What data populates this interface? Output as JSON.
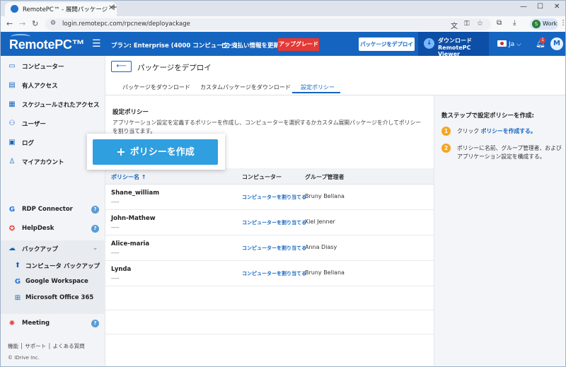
{
  "browser": {
    "tab_title": "RemotePC™ - 展開パッケージ",
    "url": "login.remotepc.com/rpcnew/deployackage",
    "profile_initial": "S",
    "profile_label": "Work"
  },
  "header": {
    "logo": "RemotePC™",
    "plan": "プラン: Enterprise (4000 コンピューター)",
    "billing": "支払い情報を更新",
    "upgrade": "アップグレード",
    "deploy": "パッケージをデプロイ",
    "download_l1": "ダウンロード",
    "download_l2": "RemotePC Viewer",
    "lang": "Ja",
    "bell_count": "1",
    "user_initial": "M"
  },
  "sidebar": {
    "items": [
      {
        "label": "コンピューター",
        "icon": "monitor-icon"
      },
      {
        "label": "有人アクセス",
        "icon": "attended-icon"
      },
      {
        "label": "スケジュールされたアクセス",
        "icon": "calendar-icon"
      },
      {
        "label": "ユーザー",
        "icon": "users-icon"
      },
      {
        "label": "ログ",
        "icon": "log-icon"
      },
      {
        "label": "マイアカウント",
        "icon": "account-icon"
      }
    ],
    "rdp": "RDP Connector",
    "helpdesk": "HelpDesk",
    "backup": "バックアップ",
    "backup_items": [
      "コンピュータ バックアップ",
      "Google Workspace",
      "Microsoft Office 365"
    ],
    "meeting": "Meeting",
    "footer_links": [
      "機能",
      "サポート",
      "よくある質問"
    ],
    "copyright": "© IDrive Inc."
  },
  "main": {
    "back": "⟵",
    "title": "パッケージをデプロイ",
    "tabs": [
      "パッケージをダウンロード",
      "カスタムパッケージをダウンロード",
      "設定ポリシー"
    ],
    "section_title": "設定ポリシー",
    "section_desc": "アプリケーション設定を定義するポリシーを作成し、コンピューターを選択するかカスタム展開パッケージを介してポリシーを割り当てます。",
    "create_button": "ポリシーを作成",
    "columns": [
      "ポリシー名 ↑",
      "コンピューター",
      "グループ管理者"
    ],
    "rows": [
      {
        "name": "Shane_william",
        "sub": "----",
        "assign": "コンピューターを割り当てる",
        "admin": "Bruny Bellana"
      },
      {
        "name": "John-Mathew",
        "sub": "----",
        "assign": "コンピューターを割り当てる",
        "admin": "Kiel Jenner"
      },
      {
        "name": "Alice-maria",
        "sub": "----",
        "assign": "コンピューターを割り当てる",
        "admin": "Anna Diasy"
      },
      {
        "name": "Lynda",
        "sub": "----",
        "assign": "コンピューターを割り当てる",
        "admin": "Bruny Bellana"
      }
    ]
  },
  "help": {
    "title": "数ステップで設定ポリシーを作成:",
    "step1_num": "1",
    "step1_pre": "クリック ",
    "step1_link": "ポリシーを作成する。",
    "step2_num": "2",
    "step2": "ポリシーに名前、グループ管理者、およびアプリケーション設定を構成する。"
  },
  "colors": {
    "brand": "#1565c0",
    "upgrade": "#e53935",
    "create": "#2f9fe0",
    "step": "#f5a623"
  }
}
